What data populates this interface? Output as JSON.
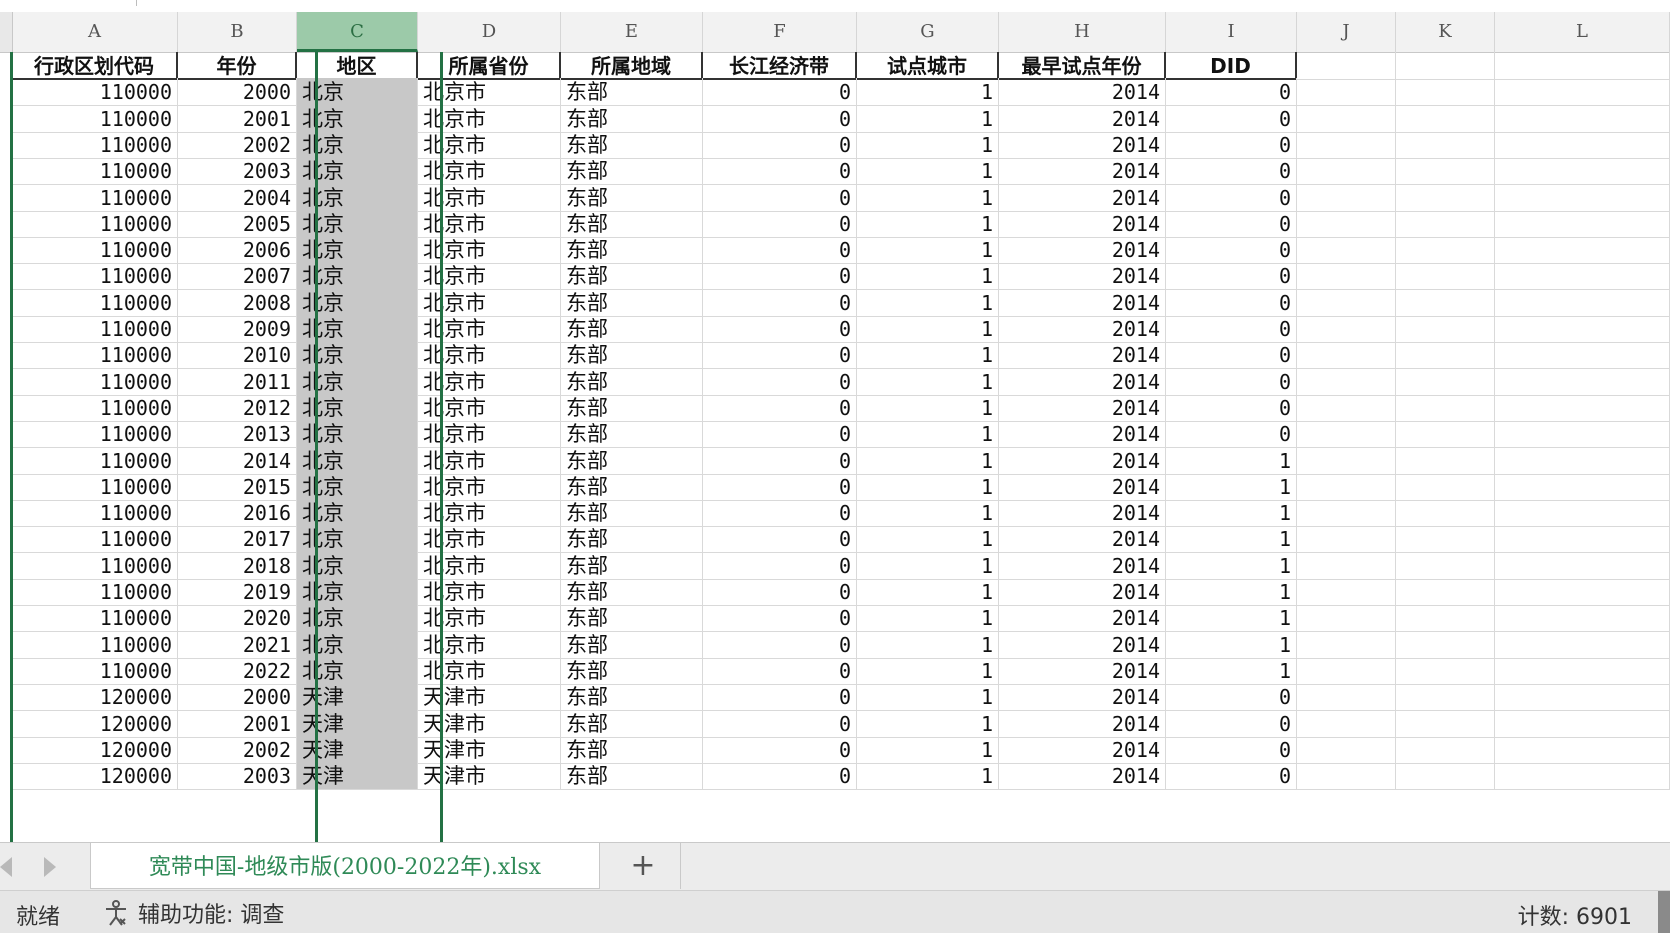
{
  "columns": [
    "A",
    "B",
    "C",
    "D",
    "E",
    "F",
    "G",
    "H",
    "I",
    "J",
    "K",
    "L"
  ],
  "selected_column": "C",
  "header_row": [
    "行政区划代码",
    "年份",
    "地区",
    "所属省份",
    "所属地域",
    "长江经济带",
    "试点城市",
    "最早试点年份",
    "DID"
  ],
  "rows": [
    [
      "110000",
      "2000",
      "北京",
      "北京市",
      "东部",
      "0",
      "1",
      "2014",
      "0"
    ],
    [
      "110000",
      "2001",
      "北京",
      "北京市",
      "东部",
      "0",
      "1",
      "2014",
      "0"
    ],
    [
      "110000",
      "2002",
      "北京",
      "北京市",
      "东部",
      "0",
      "1",
      "2014",
      "0"
    ],
    [
      "110000",
      "2003",
      "北京",
      "北京市",
      "东部",
      "0",
      "1",
      "2014",
      "0"
    ],
    [
      "110000",
      "2004",
      "北京",
      "北京市",
      "东部",
      "0",
      "1",
      "2014",
      "0"
    ],
    [
      "110000",
      "2005",
      "北京",
      "北京市",
      "东部",
      "0",
      "1",
      "2014",
      "0"
    ],
    [
      "110000",
      "2006",
      "北京",
      "北京市",
      "东部",
      "0",
      "1",
      "2014",
      "0"
    ],
    [
      "110000",
      "2007",
      "北京",
      "北京市",
      "东部",
      "0",
      "1",
      "2014",
      "0"
    ],
    [
      "110000",
      "2008",
      "北京",
      "北京市",
      "东部",
      "0",
      "1",
      "2014",
      "0"
    ],
    [
      "110000",
      "2009",
      "北京",
      "北京市",
      "东部",
      "0",
      "1",
      "2014",
      "0"
    ],
    [
      "110000",
      "2010",
      "北京",
      "北京市",
      "东部",
      "0",
      "1",
      "2014",
      "0"
    ],
    [
      "110000",
      "2011",
      "北京",
      "北京市",
      "东部",
      "0",
      "1",
      "2014",
      "0"
    ],
    [
      "110000",
      "2012",
      "北京",
      "北京市",
      "东部",
      "0",
      "1",
      "2014",
      "0"
    ],
    [
      "110000",
      "2013",
      "北京",
      "北京市",
      "东部",
      "0",
      "1",
      "2014",
      "0"
    ],
    [
      "110000",
      "2014",
      "北京",
      "北京市",
      "东部",
      "0",
      "1",
      "2014",
      "1"
    ],
    [
      "110000",
      "2015",
      "北京",
      "北京市",
      "东部",
      "0",
      "1",
      "2014",
      "1"
    ],
    [
      "110000",
      "2016",
      "北京",
      "北京市",
      "东部",
      "0",
      "1",
      "2014",
      "1"
    ],
    [
      "110000",
      "2017",
      "北京",
      "北京市",
      "东部",
      "0",
      "1",
      "2014",
      "1"
    ],
    [
      "110000",
      "2018",
      "北京",
      "北京市",
      "东部",
      "0",
      "1",
      "2014",
      "1"
    ],
    [
      "110000",
      "2019",
      "北京",
      "北京市",
      "东部",
      "0",
      "1",
      "2014",
      "1"
    ],
    [
      "110000",
      "2020",
      "北京",
      "北京市",
      "东部",
      "0",
      "1",
      "2014",
      "1"
    ],
    [
      "110000",
      "2021",
      "北京",
      "北京市",
      "东部",
      "0",
      "1",
      "2014",
      "1"
    ],
    [
      "110000",
      "2022",
      "北京",
      "北京市",
      "东部",
      "0",
      "1",
      "2014",
      "1"
    ],
    [
      "120000",
      "2000",
      "天津",
      "天津市",
      "东部",
      "0",
      "1",
      "2014",
      "0"
    ],
    [
      "120000",
      "2001",
      "天津",
      "天津市",
      "东部",
      "0",
      "1",
      "2014",
      "0"
    ],
    [
      "120000",
      "2002",
      "天津",
      "天津市",
      "东部",
      "0",
      "1",
      "2014",
      "0"
    ],
    [
      "120000",
      "2003",
      "天津",
      "天津市",
      "东部",
      "0",
      "1",
      "2014",
      "0"
    ]
  ],
  "sheet_tab": "宽带中国-地级市版(2000-2022年).xlsx",
  "add_sheet_label": "+",
  "status": {
    "ready": "就绪",
    "accessibility": "辅助功能: 调查",
    "count": "计数: 6901"
  },
  "colors": {
    "accent": "#237144",
    "tab_text": "#2f8a57",
    "selected_fill": "#c8c8c8"
  }
}
